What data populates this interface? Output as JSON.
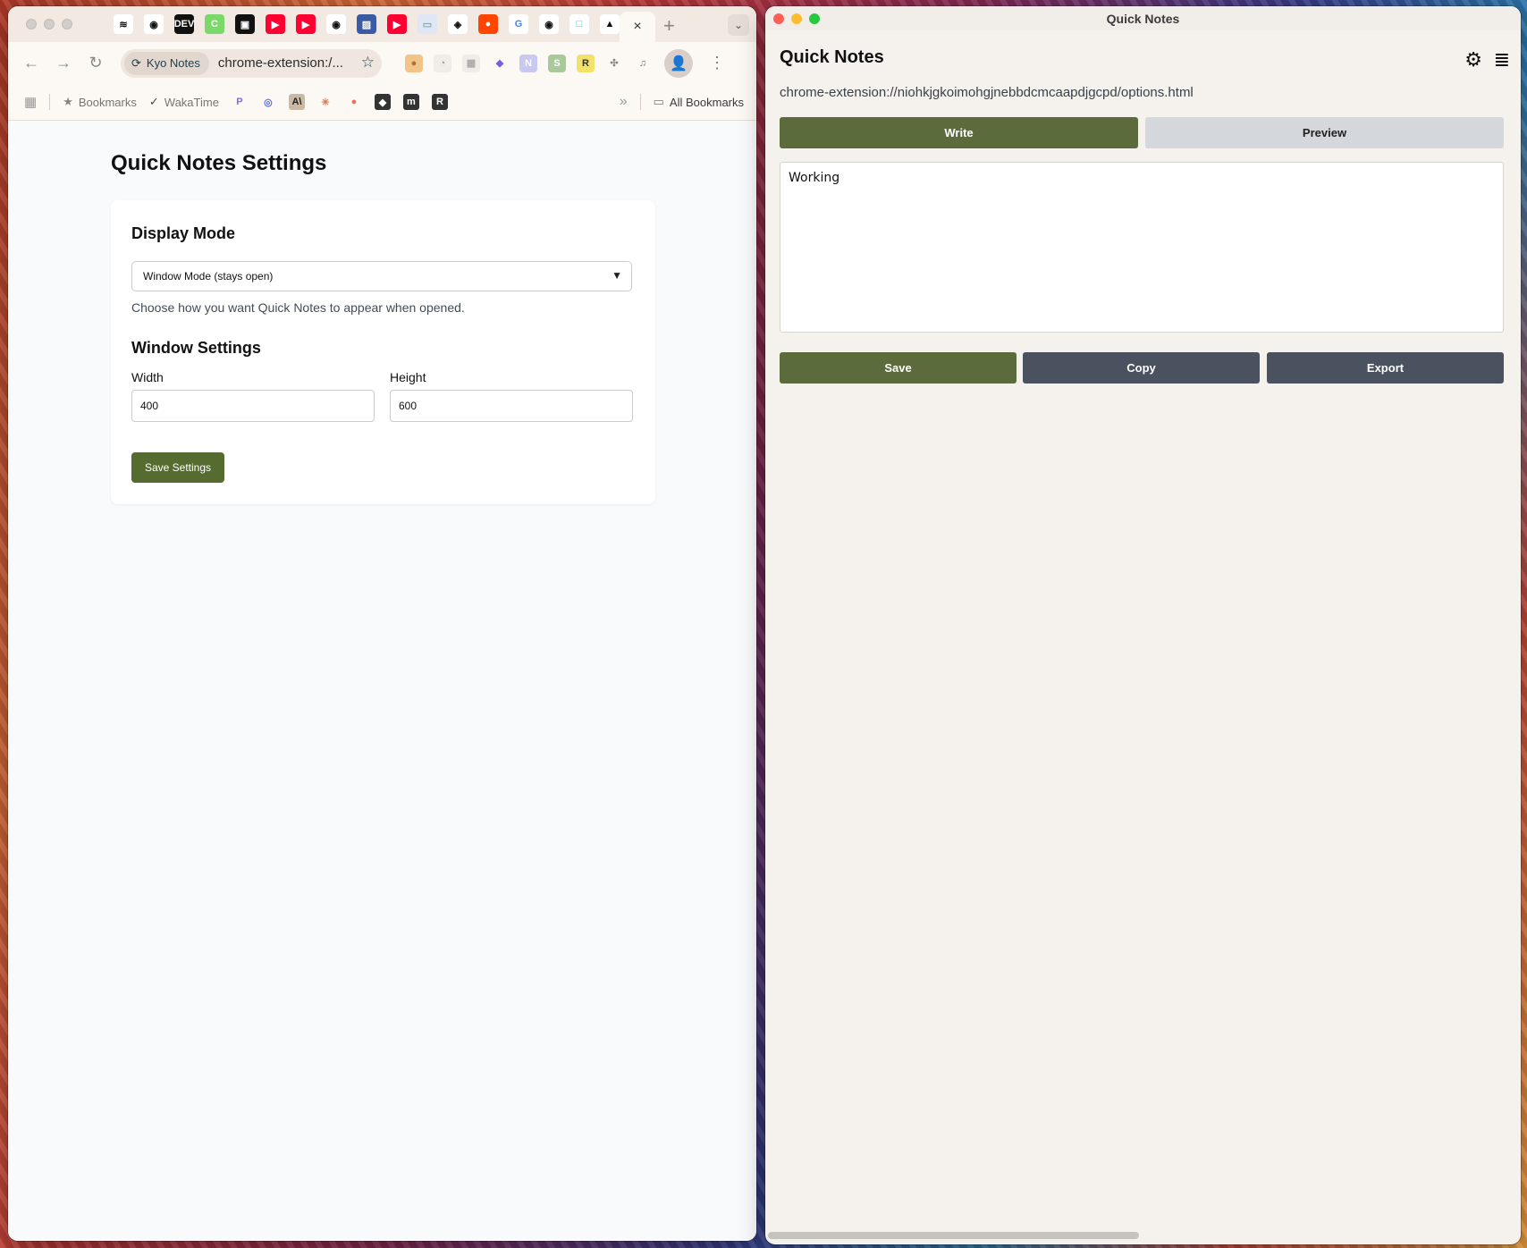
{
  "browser": {
    "tab_close": "×",
    "tab_new": "+",
    "tab_search": "⌄",
    "pinned_tabs": [
      {
        "icon": "substack-icon",
        "glyph": "≋",
        "bg": "#ffffff",
        "fg": "#111"
      },
      {
        "icon": "github-icon",
        "glyph": "◉",
        "bg": "#ffffff",
        "fg": "#111"
      },
      {
        "icon": "dev-icon",
        "glyph": "DEV",
        "bg": "#111111",
        "fg": "#fff"
      },
      {
        "icon": "c-app-icon",
        "glyph": "C",
        "bg": "#7bd96a",
        "fg": "#fff"
      },
      {
        "icon": "app-dark-icon",
        "glyph": "▣",
        "bg": "#111111",
        "fg": "#fff"
      },
      {
        "icon": "youtube-icon",
        "glyph": "▶",
        "bg": "#ff0033",
        "fg": "#fff"
      },
      {
        "icon": "youtube-icon",
        "glyph": "▶",
        "bg": "#ff0033",
        "fg": "#fff"
      },
      {
        "icon": "github-icon",
        "glyph": "◉",
        "bg": "#ffffff",
        "fg": "#111"
      },
      {
        "icon": "image-app-icon",
        "glyph": "▨",
        "bg": "#3b5ba5",
        "fg": "#fff"
      },
      {
        "icon": "youtube-icon",
        "glyph": "▶",
        "bg": "#ff0033",
        "fg": "#fff"
      },
      {
        "icon": "calendar-icon",
        "glyph": "▭",
        "bg": "#dfe6f5",
        "fg": "#8aa"
      },
      {
        "icon": "box-icon",
        "glyph": "◈",
        "bg": "#ffffff",
        "fg": "#111"
      },
      {
        "icon": "reddit-icon",
        "glyph": "●",
        "bg": "#ff4500",
        "fg": "#fff"
      },
      {
        "icon": "google-icon",
        "glyph": "G",
        "bg": "#ffffff",
        "fg": "#4285f4"
      },
      {
        "icon": "github-icon",
        "glyph": "◉",
        "bg": "#ffffff",
        "fg": "#111"
      },
      {
        "icon": "square-app-icon",
        "glyph": "□",
        "bg": "#ffffff",
        "fg": "#27c4d6"
      },
      {
        "icon": "arc-icon",
        "glyph": "▲",
        "bg": "#ffffff",
        "fg": "#111"
      }
    ],
    "omnibox": {
      "chip_label": "Kyo Notes",
      "url": "chrome-extension:/..."
    },
    "extensions": [
      {
        "icon": "cookie-icon",
        "glyph": "●",
        "bg": "#f2c48a",
        "fg": "#b07030"
      },
      {
        "icon": "timer-icon",
        "glyph": "◔",
        "bg": "#f0ece8",
        "fg": "#999"
      },
      {
        "icon": "grid-ext-icon",
        "glyph": "▦",
        "bg": "#f0ece8",
        "fg": "#aaa"
      },
      {
        "icon": "diamond-icon",
        "glyph": "◆",
        "bg": "#fcf8f4",
        "fg": "#7b5be0"
      },
      {
        "icon": "n-ext-icon",
        "glyph": "N",
        "bg": "#c9c8f0",
        "fg": "#fff"
      },
      {
        "icon": "s-ext-icon",
        "glyph": "S",
        "bg": "#a9c99a",
        "fg": "#fff"
      },
      {
        "icon": "r-ext-icon",
        "glyph": "R",
        "bg": "#f3e26a",
        "fg": "#333"
      },
      {
        "icon": "puzzle-icon",
        "glyph": "✣",
        "bg": "#fcf8f4",
        "fg": "#888"
      },
      {
        "icon": "media-control-icon",
        "glyph": "♫",
        "bg": "#fcf8f4",
        "fg": "#777"
      }
    ],
    "bookmarks": {
      "items": [
        {
          "label": "Bookmarks",
          "icon": "star-icon",
          "glyph": "★"
        },
        {
          "label": "WakaTime",
          "icon": "wakatime-icon",
          "glyph": "✓"
        }
      ],
      "icon_only": [
        {
          "icon": "p-bookmark-icon",
          "glyph": "P",
          "bg": "#fcf8f4",
          "fg": "#7b6ee0"
        },
        {
          "icon": "circle-bookmark-icon",
          "glyph": "◎",
          "bg": "#fcf8f4",
          "fg": "#5a6ee0"
        },
        {
          "icon": "anthropic-icon",
          "glyph": "A\\",
          "bg": "#c9b9a5",
          "fg": "#222"
        },
        {
          "icon": "claude-icon",
          "glyph": "✳",
          "bg": "#fcf8f4",
          "fg": "#d87a4a"
        },
        {
          "icon": "o-bookmark-icon",
          "glyph": "●",
          "bg": "#fcf8f4",
          "fg": "#e7735a"
        },
        {
          "icon": "dark-bookmark-icon",
          "glyph": "◆",
          "bg": "#333333",
          "fg": "#fff"
        },
        {
          "icon": "m-bookmark-icon",
          "glyph": "m",
          "bg": "#333333",
          "fg": "#fff"
        },
        {
          "icon": "r-bookmark-icon",
          "glyph": "R",
          "bg": "#333333",
          "fg": "#fff"
        }
      ],
      "overflow": "»",
      "all_bookmarks": "All Bookmarks"
    }
  },
  "settings_page": {
    "title": "Quick Notes Settings",
    "display_mode": {
      "heading": "Display Mode",
      "selected": "Window Mode (stays open)",
      "hint": "Choose how you want Quick Notes to appear when opened."
    },
    "window_settings": {
      "heading": "Window Settings",
      "width_label": "Width",
      "width_value": "400",
      "height_label": "Height",
      "height_value": "600"
    },
    "save_label": "Save Settings"
  },
  "quick_notes": {
    "window_title": "Quick Notes",
    "header": "Quick Notes",
    "page_url": "chrome-extension://niohkjgkoimohgjnebbdcmcaapdjgcpd/options.html",
    "tabs": {
      "write": "Write",
      "preview": "Preview"
    },
    "note_text": "Working",
    "buttons": {
      "save": "Save",
      "copy": "Copy",
      "export": "Export"
    },
    "accent_color": "#5b6b3b",
    "secondary_color": "#4a5260"
  }
}
